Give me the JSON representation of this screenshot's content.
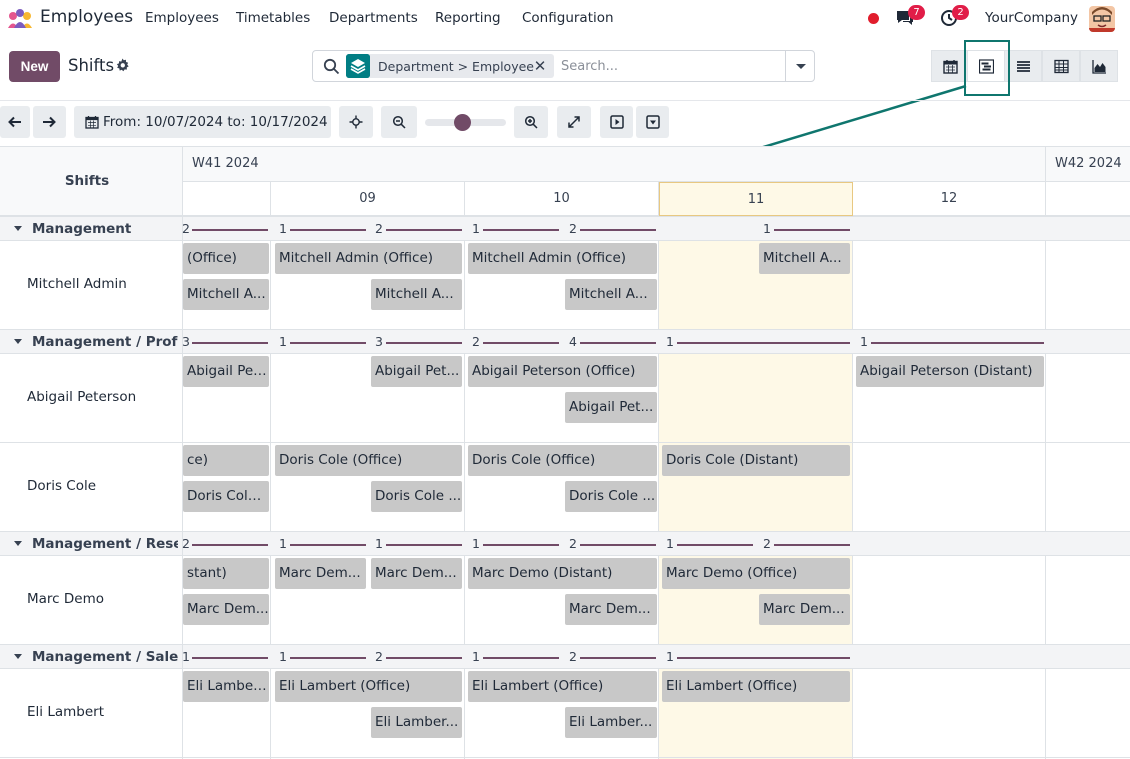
{
  "nav": {
    "app_title": "Employees",
    "menu": [
      "Employees",
      "Timetables",
      "Departments",
      "Reporting",
      "Configuration"
    ],
    "messages_badge": "7",
    "activities_badge": "2",
    "company": "YourCompany"
  },
  "control_panel": {
    "new_label": "New",
    "title": "Shifts",
    "facet_label": "Department > Employee",
    "search_placeholder": "Search..."
  },
  "toolbar": {
    "date_range_label": "From: 10/07/2024 to: 10/17/2024",
    "zoom_level_fraction": 0.45
  },
  "gantt": {
    "header_title": "Shifts",
    "weeks": [
      "W41 2024",
      "W42 2024"
    ],
    "days": [
      "09",
      "10",
      "11",
      "12"
    ],
    "groups": [
      {
        "label": "Management",
        "counts": [
          "2",
          "1",
          "2",
          "1",
          "2",
          "1"
        ],
        "employees": [
          {
            "name": "Mitchell Admin",
            "shifts": [
              "(Office)",
              "Mitchell Admin (Office)",
              "Mitchell Admin (Office)",
              "Mitchell A...",
              "Mitchell A...",
              "Mitchell A...",
              "Mitchell A..."
            ]
          }
        ]
      },
      {
        "label": "Management / Prof...",
        "counts": [
          "3",
          "1",
          "3",
          "2",
          "4",
          "1",
          "1"
        ],
        "employees": [
          {
            "name": "Abigail Peterson",
            "shifts": [
              "Abigail Pet...",
              "Abigail Pet...",
              "Abigail Peterson (Office)",
              "Abigail Peterson (Distant)",
              "Abigail Pet..."
            ]
          },
          {
            "name": "Doris Cole",
            "shifts": [
              "ce)",
              "Doris Cole (Office)",
              "Doris Cole (Office)",
              "Doris Cole (Distant)",
              "Doris Cole ...",
              "Doris Cole ...",
              "Doris Cole ..."
            ]
          }
        ]
      },
      {
        "label": "Management / Rese...",
        "counts": [
          "2",
          "1",
          "1",
          "1",
          "2",
          "1",
          "2"
        ],
        "employees": [
          {
            "name": "Marc Demo",
            "shifts": [
              "stant)",
              "Marc Dem...",
              "Marc Dem...",
              "Marc Demo (Distant)",
              "Marc Demo (Office)",
              "Marc Dem...",
              "Marc Dem...",
              "Marc Dem..."
            ]
          }
        ]
      },
      {
        "label": "Management / Sales",
        "counts": [
          "1",
          "1",
          "2",
          "1",
          "2",
          "1"
        ],
        "employees": [
          {
            "name": "Eli Lambert",
            "shifts": [
              "Eli Lamber...",
              "Eli Lambert (Office)",
              "Eli Lambert (Office)",
              "Eli Lambert (Office)",
              "Eli Lamber...",
              "Eli Lamber..."
            ]
          }
        ]
      }
    ]
  }
}
